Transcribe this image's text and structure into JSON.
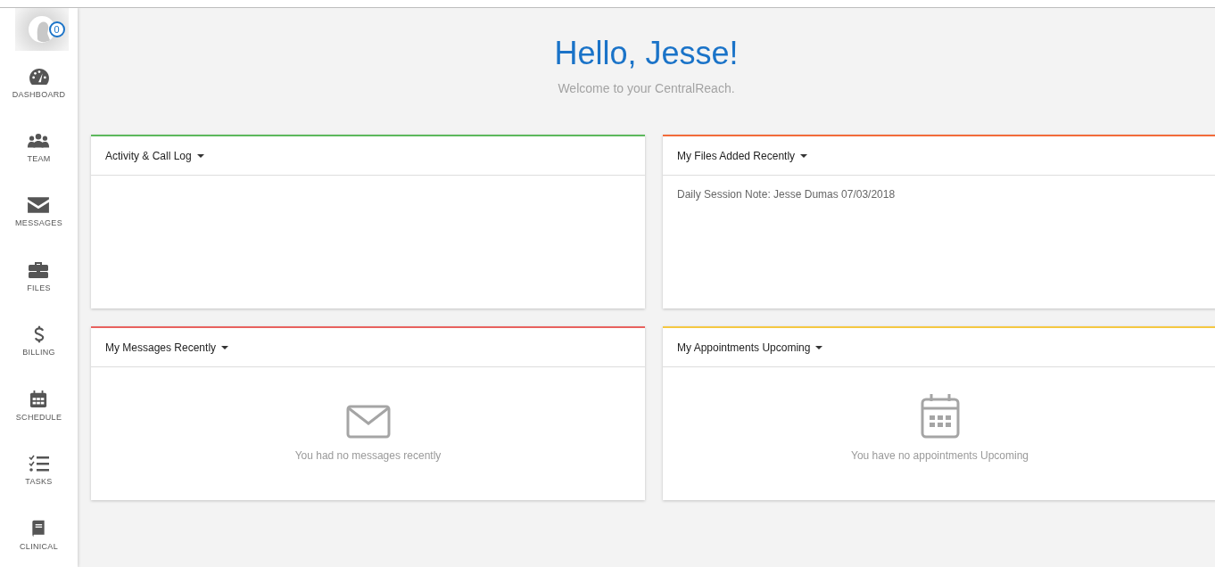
{
  "user": {
    "badge": "0"
  },
  "sidebar": {
    "items": [
      {
        "label": "DASHBOARD",
        "kind": "dashboard"
      },
      {
        "label": "TEAM",
        "kind": "team"
      },
      {
        "label": "MESSAGES",
        "kind": "messages"
      },
      {
        "label": "FILES",
        "kind": "files"
      },
      {
        "label": "BILLING",
        "kind": "billing"
      },
      {
        "label": "SCHEDULE",
        "kind": "schedule"
      },
      {
        "label": "TASKS",
        "kind": "tasks"
      },
      {
        "label": "CLINICAL",
        "kind": "clinical"
      }
    ]
  },
  "greeting": {
    "title": "Hello, Jesse!",
    "subtitle": "Welcome to your CentralReach."
  },
  "cards": [
    {
      "title": "Activity & Call Log",
      "color": "#5cb85c",
      "kind": "list"
    },
    {
      "title": "My Files Added Recently",
      "color": "#f26b3a",
      "kind": "list",
      "items": [
        "Daily Session Note: Jesse Dumas 07/03/2018"
      ]
    },
    {
      "title": "My Messages Recently",
      "color": "#e8625f",
      "kind": "mail",
      "message": "You had no messages recently"
    },
    {
      "title": "My Appointments Upcoming",
      "color": "#f5c842",
      "kind": "calendar",
      "message": "You have no appointments Upcoming"
    }
  ]
}
